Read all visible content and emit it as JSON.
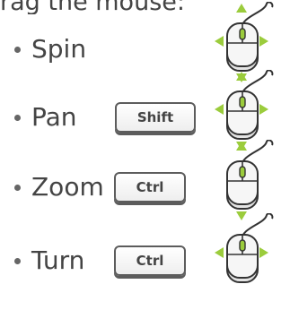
{
  "header": {
    "text": "rag the mouse:"
  },
  "rows": [
    {
      "label": "Spin",
      "key": null,
      "arrows": [
        "up",
        "down",
        "left",
        "right"
      ]
    },
    {
      "label": "Pan",
      "key": "Shift",
      "arrows": [
        "up",
        "down",
        "left",
        "right"
      ]
    },
    {
      "label": "Zoom",
      "key": "Ctrl",
      "arrows": [
        "up",
        "down"
      ]
    },
    {
      "label": "Turn",
      "key": "Ctrl",
      "arrows": [
        "left",
        "right"
      ]
    }
  ],
  "colors": {
    "arrow": "#9bcc3c",
    "mouse_stroke": "#333333",
    "mouse_fill": "#f2f2f2",
    "wheel": "#9bcc3c"
  },
  "icons": {
    "mouse": "mouse-icon",
    "arrow": "triangle-arrow-icon"
  }
}
